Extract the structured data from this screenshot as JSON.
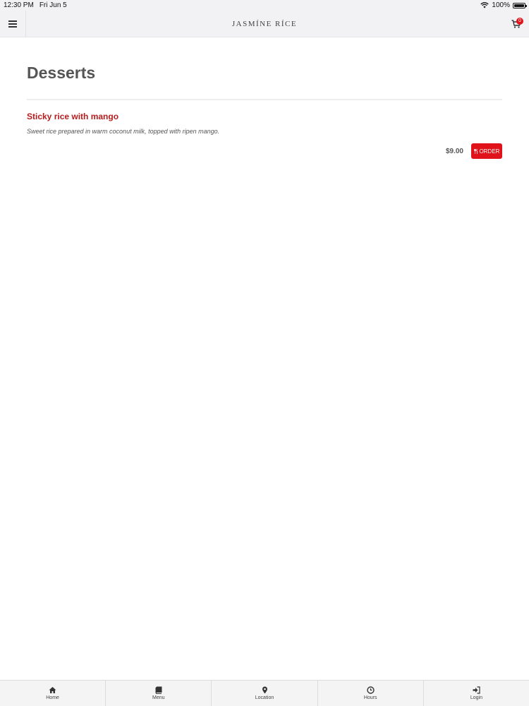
{
  "status_bar": {
    "time": "12:30 PM",
    "date": "Fri Jun 5",
    "battery": "100%"
  },
  "header": {
    "logo": "JASMÍNE RÍCE",
    "cart_count": "0"
  },
  "main": {
    "section_title": "Desserts",
    "items": [
      {
        "name": "Sticky rice with mango",
        "description": "Sweet rice prepared in warm coconut milk, topped with ripen mango.",
        "price": "$9.00",
        "order_label": "ORDER"
      }
    ]
  },
  "tabbar": {
    "tabs": [
      {
        "label": "Home",
        "icon": "home-icon"
      },
      {
        "label": "Menu",
        "icon": "book-icon"
      },
      {
        "label": "Location",
        "icon": "map-pin-icon"
      },
      {
        "label": "Hours",
        "icon": "clock-icon"
      },
      {
        "label": "Login",
        "icon": "login-icon"
      }
    ]
  },
  "colors": {
    "accent": "#e0131a",
    "item_title": "#b81c1c",
    "header_bg": "#f2f1f3"
  }
}
